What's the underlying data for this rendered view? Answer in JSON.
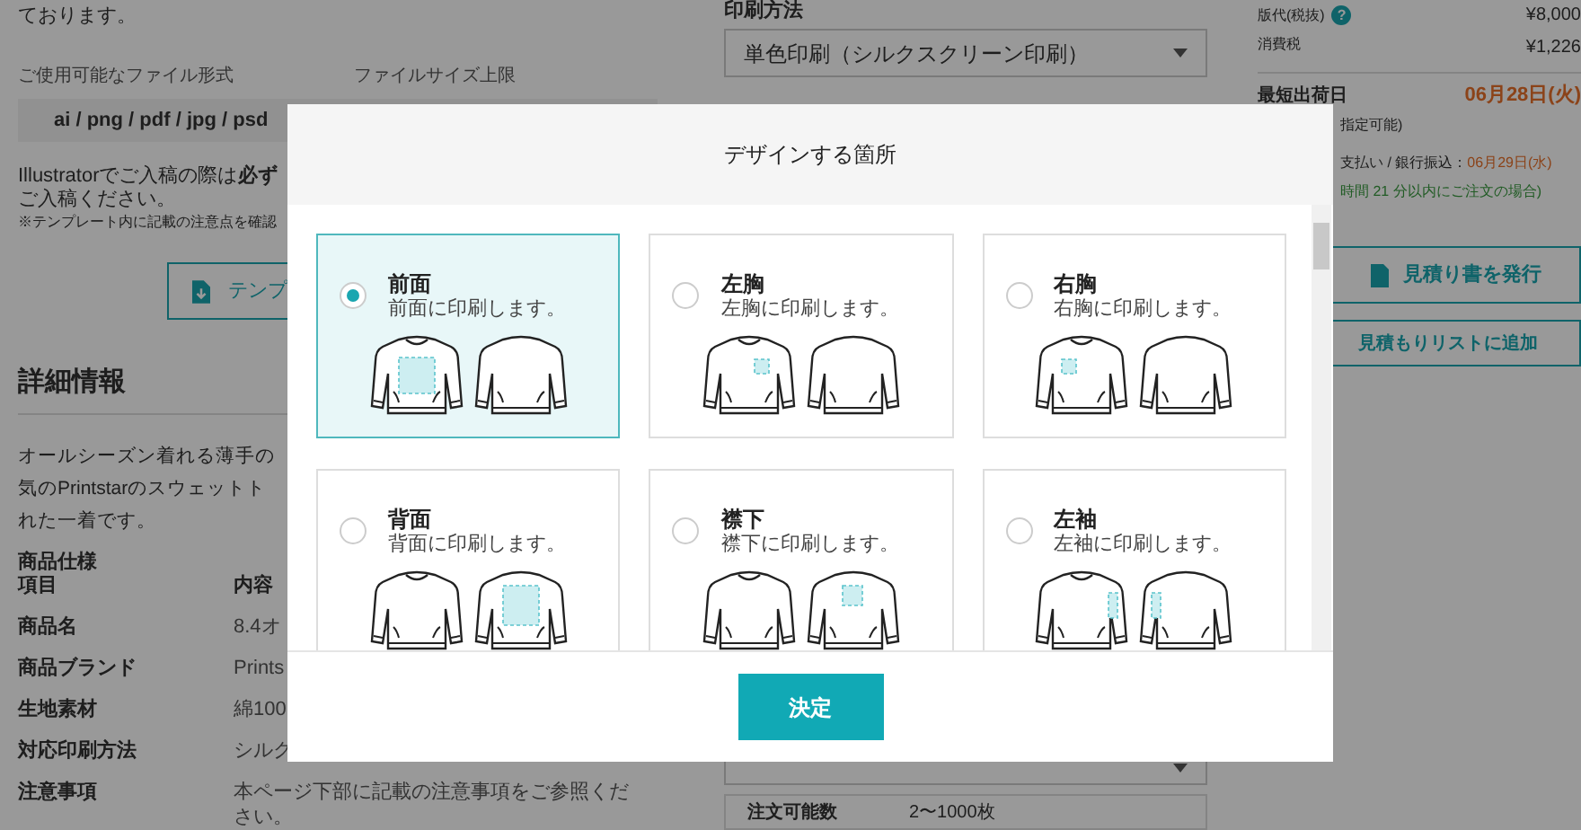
{
  "page": {
    "left": {
      "intro_tail": "ております。",
      "file_formats_label": "ご使用可能なファイル形式",
      "file_size_label": "ファイルサイズ上限",
      "file_formats_value": "ai / png / pdf / jpg / psd",
      "illustrator_note": "Illustratorでご入稿の際は**必ず**",
      "illustrator_note_2": "ご入稿ください。",
      "template_note": "※テンプレート内に記載の注意点を確認",
      "template_button": "テンプ",
      "details_heading": "詳細情報",
      "description_lines": [
        "オールシーズン着れる薄手の",
        "気のPrintstarのスウェットト",
        "れた一着です。"
      ],
      "spec_heading": "商品仕様",
      "spec_columns": [
        "項目",
        "内容"
      ],
      "spec_rows": [
        {
          "label": "商品名",
          "value": "8.4オ"
        },
        {
          "label": "商品ブランド",
          "value": "Prints"
        },
        {
          "label": "生地素材",
          "value": "綿100"
        },
        {
          "label": "対応印刷方法",
          "value": "シルク"
        },
        {
          "label": "注意事項",
          "value": "本ページ下部に記載の注意事項をご参照ください。"
        }
      ]
    },
    "middle": {
      "print_method_label": "印刷方法",
      "print_method_value": "単色印刷（シルクスクリーン印刷）",
      "order_quantity_label": "注文可能数",
      "order_quantity_value": "2〜1000枚"
    },
    "right": {
      "plate_fee_label": "版代(税抜)",
      "help_icon": "?",
      "plate_fee": "¥8,000",
      "tax_label": "消費税",
      "tax": "¥1,226",
      "ship_label": "最短出荷日",
      "ship_date": "06月28日(火)",
      "ship_note": "指定可能)",
      "payment_note": "支払い / 銀行振込：",
      "payment_date": "06月29日(水)",
      "deadline_note": "時間 21 分以内にご注文の場合)",
      "quote_button": "見積り書を発行",
      "add_list_button": "見積もりリストに追加"
    }
  },
  "modal": {
    "title": "デザインする箇所",
    "options": [
      {
        "title": "前面",
        "description": "前面に印刷します。",
        "kind": "front",
        "selected": true
      },
      {
        "title": "左胸",
        "description": "左胸に印刷します。",
        "kind": "left_chest",
        "selected": false
      },
      {
        "title": "右胸",
        "description": "右胸に印刷します。",
        "kind": "right_chest",
        "selected": false
      },
      {
        "title": "背面",
        "description": "背面に印刷します。",
        "kind": "back",
        "selected": false
      },
      {
        "title": "襟下",
        "description": "襟下に印刷します。",
        "kind": "nape",
        "selected": false
      },
      {
        "title": "左袖",
        "description": "左袖に印刷します。",
        "kind": "left_sleeve",
        "selected": false
      }
    ],
    "confirm_button": "決定"
  }
}
